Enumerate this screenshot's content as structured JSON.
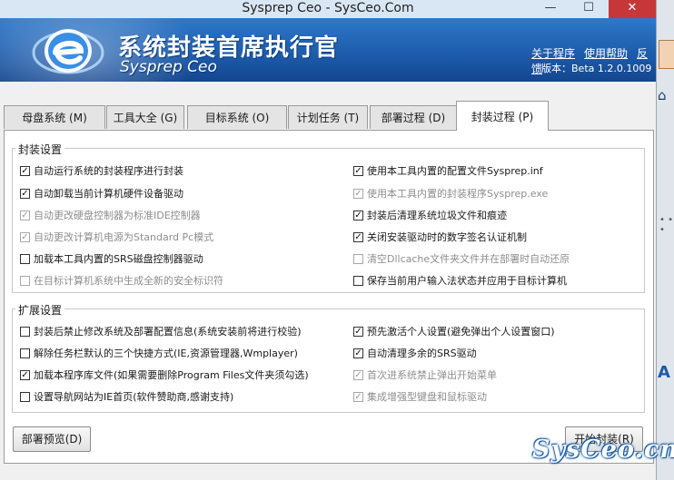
{
  "window": {
    "title": "Sysprep Ceo - SysCeo.Com",
    "minimize": "—",
    "maximize": "☐",
    "close": "✕"
  },
  "header": {
    "app_title": "系统封装首席执行官",
    "app_subtitle": "Sysprep  Ceo",
    "links": [
      "关于程序",
      "使用帮助",
      "反馈"
    ],
    "version": "版本：Beta 1.2.0.1009",
    "logo_icon": "blue-e-logo-icon"
  },
  "tabs": [
    {
      "label": "母盘系统 (M)",
      "active": false
    },
    {
      "label": "工具大全 (G)",
      "active": false
    },
    {
      "label": "目标系统 (O)",
      "active": false
    },
    {
      "label": "计划任务 (T)",
      "active": false
    },
    {
      "label": "部署过程 (D)",
      "active": false
    },
    {
      "label": "封装过程 (P)",
      "active": true
    }
  ],
  "groups": {
    "pack": {
      "title": "封装设置",
      "left": [
        {
          "label": "自动运行系统的封装程序进行封装",
          "checked": true,
          "disabled": false
        },
        {
          "label": "自动卸载当前计算机硬件设备驱动",
          "checked": true,
          "disabled": false
        },
        {
          "label": "自动更改硬盘控制器为标准IDE控制器",
          "checked": true,
          "disabled": true
        },
        {
          "label": "自动更改计算机电源为Standard Pc模式",
          "checked": true,
          "disabled": true
        },
        {
          "label": "加载本工具内置的SRS磁盘控制器驱动",
          "checked": false,
          "disabled": false
        },
        {
          "label": "在目标计算机系统中生成全新的安全标识符",
          "checked": false,
          "disabled": true
        }
      ],
      "right": [
        {
          "label": "使用本工具内置的配置文件Sysprep.inf",
          "checked": true,
          "disabled": false
        },
        {
          "label": "使用本工具内置的封装程序Sysprep.exe",
          "checked": true,
          "disabled": true
        },
        {
          "label": "封装后清理系统垃圾文件和痕迹",
          "checked": true,
          "disabled": false
        },
        {
          "label": "关闭安装驱动时的数字签名认证机制",
          "checked": true,
          "disabled": false
        },
        {
          "label": "清空Dllcache文件夹文件并在部署时自动还原",
          "checked": false,
          "disabled": true
        },
        {
          "label": "保存当前用户输入法状态并应用于目标计算机",
          "checked": false,
          "disabled": false
        }
      ]
    },
    "extend": {
      "title": "扩展设置",
      "left": [
        {
          "label": "封装后禁止修改系统及部署配置信息(系统安装前将进行校验)",
          "checked": false,
          "disabled": false
        },
        {
          "label": "解除任务栏默认的三个快捷方式(IE,资源管理器,Wmplayer)",
          "checked": false,
          "disabled": false
        },
        {
          "label": "加载本程序库文件(如果需要删除Program Files文件夹须勾选)",
          "checked": true,
          "disabled": false
        },
        {
          "label": "设置导航网站为IE首页(软件赞助商,感谢支持)",
          "checked": false,
          "disabled": false
        }
      ],
      "right": [
        {
          "label": "预先激活个人设置(避免弹出个人设置窗口)",
          "checked": true,
          "disabled": false
        },
        {
          "label": "自动清理多余的SRS驱动",
          "checked": true,
          "disabled": false
        },
        {
          "label": "首次进系统禁止弹出开始菜单",
          "checked": true,
          "disabled": true
        },
        {
          "label": "集成增强型键盘和鼠标驱动",
          "checked": true,
          "disabled": true
        }
      ]
    }
  },
  "buttons": {
    "preview": "部署预览(D)",
    "start": "开始封装(R)"
  },
  "watermark": "SysCeo.cn",
  "sidebar": {
    "home_icon": "home-icon",
    "dots": "• • •",
    "letter": "A"
  }
}
